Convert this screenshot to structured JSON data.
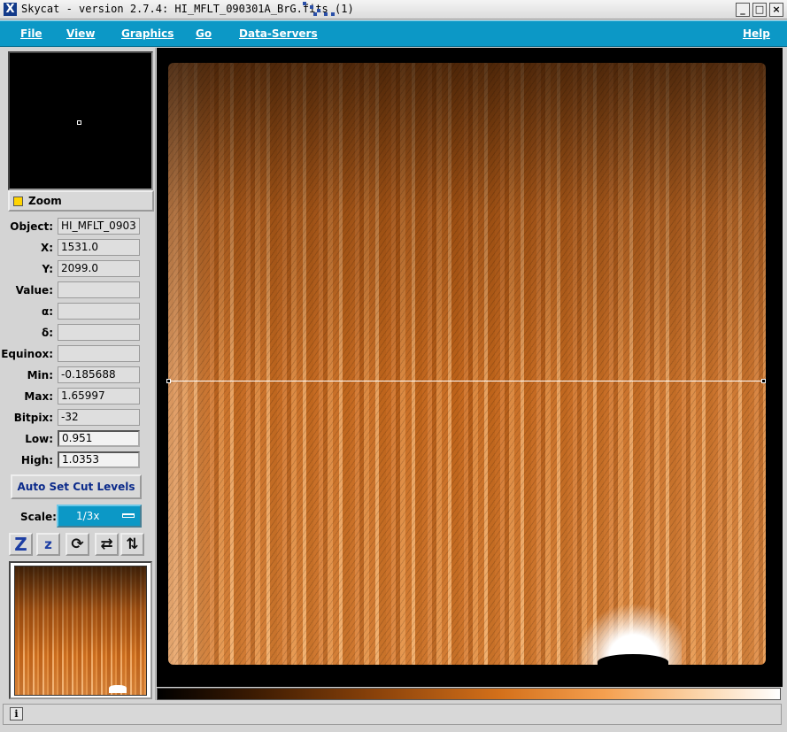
{
  "window": {
    "title": "Skycat - version 2.7.4: HI_MFLT_090301A_BrG.fits (1)",
    "controls": [
      "_",
      "□",
      "×"
    ]
  },
  "menu": {
    "items": [
      "File",
      "View",
      "Graphics",
      "Go",
      "Data-Servers"
    ],
    "help": "Help"
  },
  "zoom": {
    "label": "Zoom"
  },
  "info": [
    {
      "label": "Object:",
      "value": "HI_MFLT_0903"
    },
    {
      "label": "X:",
      "value": "1531.0"
    },
    {
      "label": "Y:",
      "value": "2099.0"
    },
    {
      "label": "Value:",
      "value": ""
    },
    {
      "label": "α:",
      "value": ""
    },
    {
      "label": "δ:",
      "value": ""
    },
    {
      "label": "Equinox:",
      "value": ""
    },
    {
      "label": "Min:",
      "value": "-0.185688"
    },
    {
      "label": "Max:",
      "value": "1.65997"
    },
    {
      "label": "Bitpix:",
      "value": "-32"
    },
    {
      "label": "Low:",
      "value": "0.951"
    },
    {
      "label": "High:",
      "value": "1.0353"
    }
  ],
  "auto_cut": {
    "label": "Auto Set Cut Levels"
  },
  "scale": {
    "label": "Scale:",
    "value": "1/3x"
  },
  "tools": [
    {
      "name": "zoom-in-icon",
      "glyph": "Z"
    },
    {
      "name": "zoom-out-icon",
      "glyph": "z"
    },
    {
      "name": "rotate-icon",
      "glyph": "⟳"
    },
    {
      "name": "flip-x-icon",
      "glyph": "⇄"
    },
    {
      "name": "flip-y-icon",
      "glyph": "⇅"
    }
  ],
  "status": {
    "icon": "i",
    "text": ""
  },
  "colors": {
    "menubar": "#0c98c6",
    "image_base": "#c76a1f",
    "auto_cut_text": "#0b2a8a"
  }
}
